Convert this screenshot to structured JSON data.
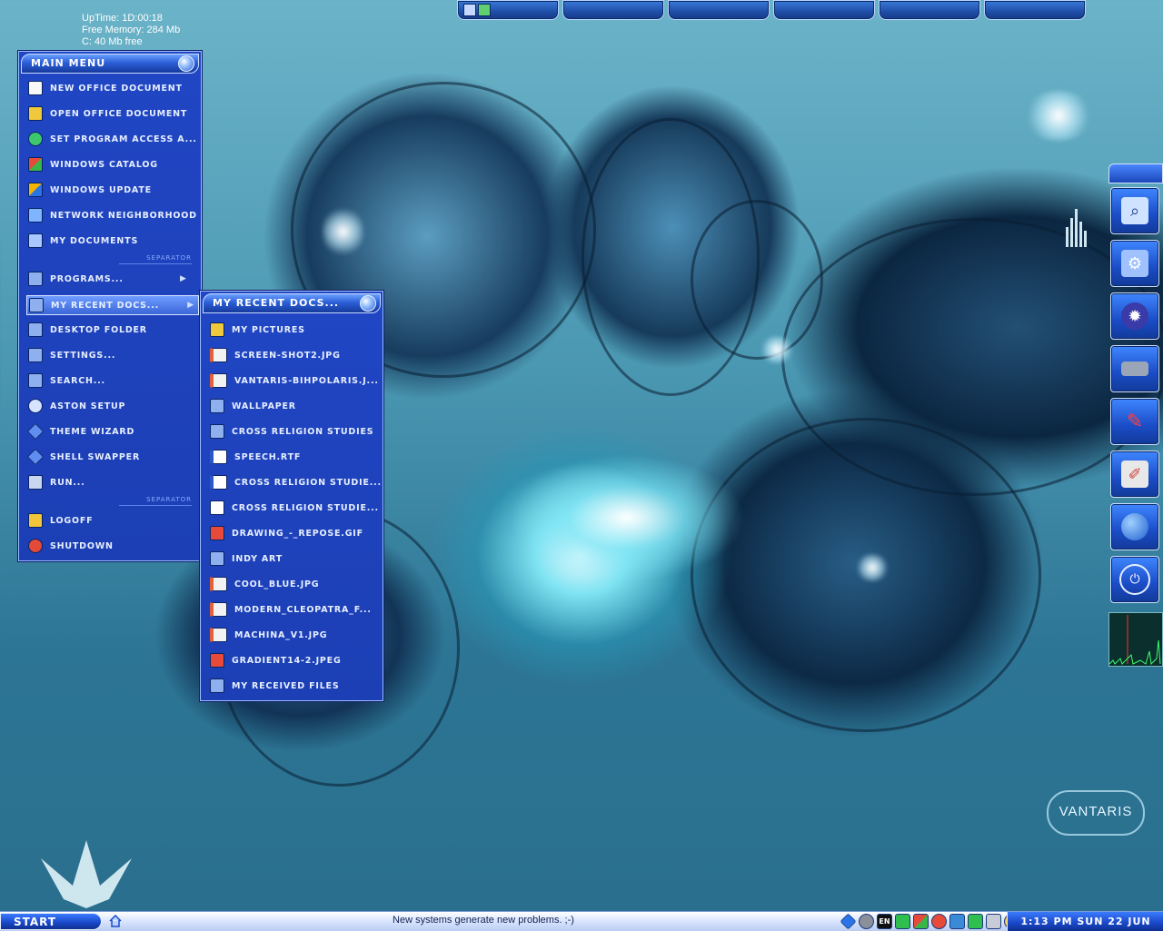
{
  "sysinfo": {
    "uptime": "UpTime: 1D:00:18",
    "memory": "Free Memory: 284 Mb",
    "disk": "C: 40 Mb free"
  },
  "main_menu": {
    "title": "Main Menu",
    "items": [
      {
        "label": "New Office Document",
        "icon": "office-document-icon"
      },
      {
        "label": "Open Office Document",
        "icon": "open-folder-icon"
      },
      {
        "label": "Set Program Access a...",
        "icon": "program-access-icon"
      },
      {
        "label": "Windows Catalog",
        "icon": "windows-catalog-icon"
      },
      {
        "label": "Windows Update",
        "icon": "windows-update-icon"
      },
      {
        "label": "Network Neighborhood",
        "icon": "network-icon"
      },
      {
        "label": "My Documents",
        "icon": "documents-icon"
      },
      {
        "label": "Programs...",
        "icon": "folder-icon"
      },
      {
        "label": "My Recent Docs...",
        "icon": "folder-icon"
      },
      {
        "label": "Desktop Folder",
        "icon": "folder-icon"
      },
      {
        "label": "Settings...",
        "icon": "folder-icon"
      },
      {
        "label": "Search...",
        "icon": "folder-icon"
      },
      {
        "label": "Aston Setup",
        "icon": "gear-icon"
      },
      {
        "label": "Theme Wizard",
        "icon": "diamond-icon"
      },
      {
        "label": "Shell Swapper",
        "icon": "diamond-icon"
      },
      {
        "label": "Run...",
        "icon": "run-icon"
      },
      {
        "label": "Logoff",
        "icon": "key-icon"
      },
      {
        "label": "Shutdown",
        "icon": "power-icon"
      }
    ],
    "separator": "Separator"
  },
  "recent_menu": {
    "title": "My Recent Docs...",
    "items": [
      {
        "label": "My Pictures"
      },
      {
        "label": "screen-shot2.jpg"
      },
      {
        "label": "Vantaris-bihpolaris.j..."
      },
      {
        "label": "Wallpaper"
      },
      {
        "label": "Cross Religion Studies"
      },
      {
        "label": "Speech.rtf"
      },
      {
        "label": "Cross Religion Studie..."
      },
      {
        "label": "Cross Religion Studie..."
      },
      {
        "label": "Drawing_-_Repose.gif"
      },
      {
        "label": "Indy Art"
      },
      {
        "label": "cool_blue.jpg"
      },
      {
        "label": "modern_cleopatra_f..."
      },
      {
        "label": "machina_v1.jpg"
      },
      {
        "label": "gradient14-2.jpeg"
      },
      {
        "label": "My Received Files"
      }
    ]
  },
  "dock": {
    "items": [
      {
        "icon": "search-icon"
      },
      {
        "icon": "settings-icon"
      },
      {
        "icon": "gear-icon"
      },
      {
        "icon": "chip-icon"
      },
      {
        "icon": "pen-icon"
      },
      {
        "icon": "paint-icon"
      },
      {
        "icon": "globe-icon"
      },
      {
        "icon": "power-icon"
      }
    ]
  },
  "logo": {
    "text": "VANTARIS"
  },
  "taskbar": {
    "start_label": "Start",
    "message": "New systems generate new problems. ;-)",
    "lang": "EN",
    "clock": "1:13 PM SUN 22 JUN"
  },
  "colors": {
    "menu_bg": "#1f44bd",
    "menu_border": "#9fc0ff",
    "taskbar_bg": "#dfe9ff",
    "accent": "#1846c6"
  }
}
